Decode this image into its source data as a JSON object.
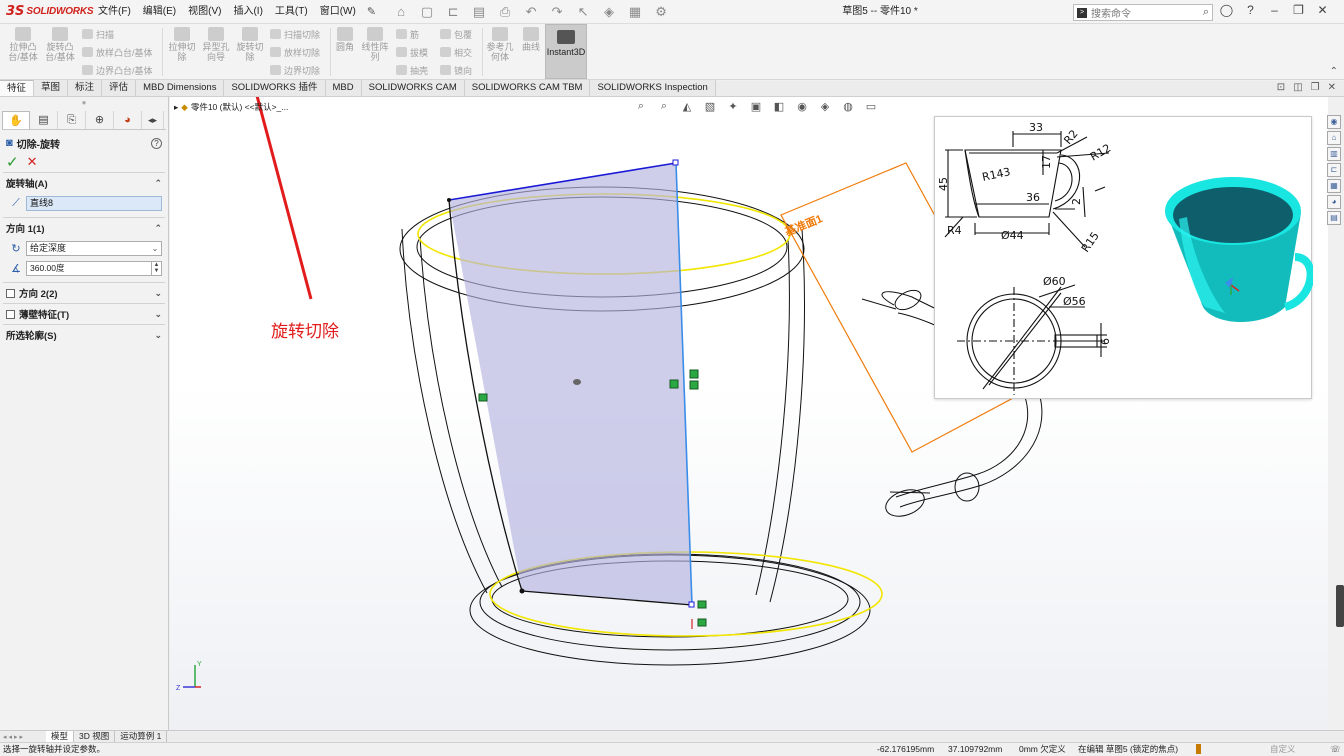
{
  "app": {
    "logo_mark": "3S",
    "logo_word": "SOLIDWORKS",
    "document_title": "草图5 -- 零件10 *"
  },
  "menu": [
    {
      "label": "文件(F)"
    },
    {
      "label": "编辑(E)"
    },
    {
      "label": "视图(V)"
    },
    {
      "label": "插入(I)"
    },
    {
      "label": "工具(T)"
    },
    {
      "label": "窗口(W)"
    }
  ],
  "search": {
    "placeholder": "搜索命令"
  },
  "command_manager": {
    "extrude_boss": "拉伸凸\n台/基体",
    "revolve_boss": "旋转凸\n台/基体",
    "sweep": "扫描",
    "loft_boss": "放样凸台/基体",
    "boundary_boss": "边界凸台/基体",
    "extrude_cut": "拉伸切\n除",
    "hole_wizard": "异型孔\n向导",
    "revolve_cut": "旋转切\n除",
    "swept_cut": "扫描切除",
    "lofted_cut": "放样切除",
    "boundary_cut": "边界切除",
    "fillet": "圆角",
    "linear_pattern": "线性阵\n列",
    "rib": "筋",
    "draft": "拔模",
    "shell": "抽壳",
    "wrap": "包覆",
    "intersect": "相交",
    "mirror": "镜向",
    "ref_geometry": "参考几\n何体",
    "curves": "曲线",
    "instant3d": "Instant3D"
  },
  "ribbon_tabs": [
    {
      "label": "特征",
      "active": true
    },
    {
      "label": "草图",
      "active": false
    },
    {
      "label": "标注",
      "active": false
    },
    {
      "label": "评估",
      "active": false
    },
    {
      "label": "MBD Dimensions",
      "active": false
    },
    {
      "label": "SOLIDWORKS 插件",
      "active": false
    },
    {
      "label": "MBD",
      "active": false
    },
    {
      "label": "SOLIDWORKS CAM",
      "active": false
    },
    {
      "label": "SOLIDWORKS CAM TBM",
      "active": false
    },
    {
      "label": "SOLIDWORKS Inspection",
      "active": false
    }
  ],
  "property_manager": {
    "title": "切除-旋转",
    "help": "?",
    "axis_section": "旋转轴(A)",
    "axis_value": "直线8",
    "direction1_section": "方向 1(1)",
    "end_condition": "给定深度",
    "angle": "360.00度",
    "direction2_section": "方向 2(2)",
    "thin_feature_section": "薄壁特征(T)",
    "selected_contours_section": "所选轮廓(S)"
  },
  "viewport": {
    "breadcrumb": "零件10 (默认) <<默认>_...",
    "annotation_text": "旋转切除",
    "plane_label": "基准面1",
    "axis_y": "Y",
    "axis_z": "Z"
  },
  "reference_drawing": {
    "dim_33": "33",
    "dim_r2": "R2",
    "dim_r12": "R12",
    "dim_17": "17",
    "dim_45": "45",
    "dim_r143": "R143",
    "dim_36": "36",
    "dim_2": "2",
    "dim_r4": "R4",
    "dim_d44": "Ø44",
    "dim_r15": "R15",
    "dim_d60": "Ø60",
    "dim_d56": "Ø56",
    "dim_6": "6"
  },
  "bottom_tabs": [
    {
      "label": "模型",
      "active": true
    },
    {
      "label": "3D 视图",
      "active": false
    },
    {
      "label": "运动算例 1",
      "active": false
    }
  ],
  "status": {
    "message": "选择一旋转轴并设定参数。",
    "x": "-62.176195mm",
    "y": "37.109792mm",
    "z_def": "0mm 欠定义",
    "editing": "在编辑 草图5 (锁定的焦点)",
    "custom": "自定义"
  },
  "colors": {
    "brand_red": "#d0211c",
    "annotation_red": "#e21c1c",
    "plane_orange": "#f07b0a",
    "sketch_blue": "#1a1ad6",
    "yellow_edge": "#f2e600",
    "profile_fill": "#b4b4e0",
    "cup_cyan": "#19e5e1"
  }
}
